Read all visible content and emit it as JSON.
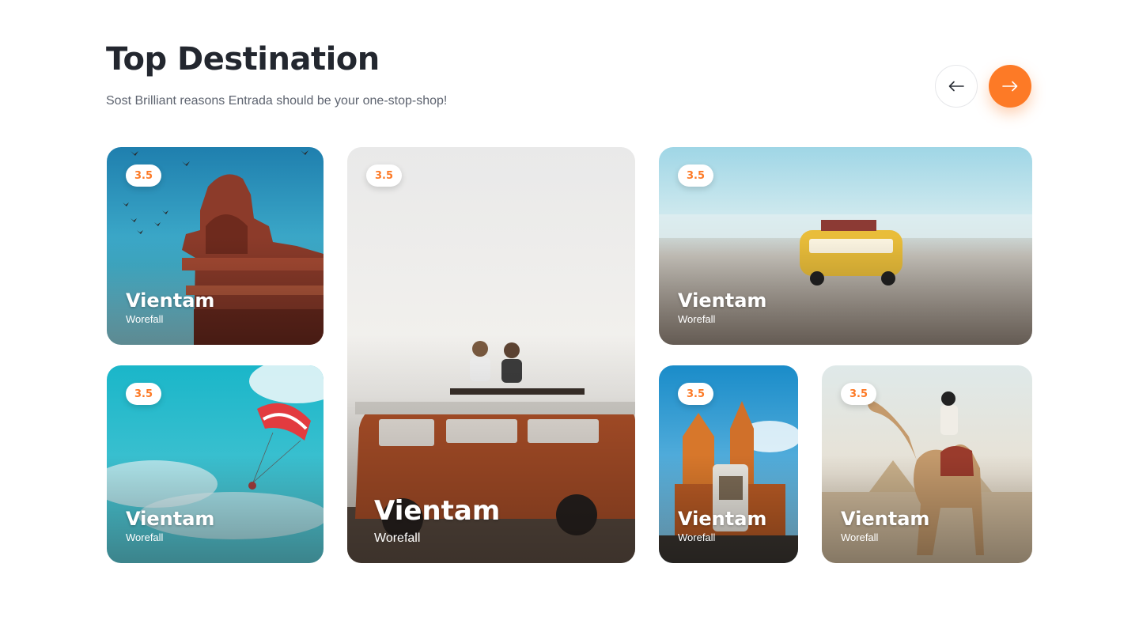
{
  "header": {
    "title": "Top Destination",
    "subtitle": "Sost Brilliant reasons Entrada should be your one-stop-shop!"
  },
  "nav": {
    "prev_icon": "arrow-left-icon",
    "next_icon": "arrow-right-icon",
    "accent_color": "#fd7a26"
  },
  "cards": [
    {
      "rating": "3.5",
      "name": "Vientam",
      "location": "Worefall",
      "scene": "red-sandstone-minaret-with-birds"
    },
    {
      "rating": "3.5",
      "name": "Vientam",
      "location": "Worefall",
      "scene": "parasailing-over-turquoise-sky"
    },
    {
      "rating": "3.5",
      "name": "Vientam",
      "location": "Worefall",
      "scene": "two-friends-on-orange-camper-van"
    },
    {
      "rating": "3.5",
      "name": "Vientam",
      "location": "Worefall",
      "scene": "toy-yellow-bus-on-beach"
    },
    {
      "rating": "3.5",
      "name": "Vientam",
      "location": "Worefall",
      "scene": "gothic-church-towers-with-camera"
    },
    {
      "rating": "3.5",
      "name": "Vientam",
      "location": "Worefall",
      "scene": "camel-rider-near-pyramids"
    }
  ]
}
